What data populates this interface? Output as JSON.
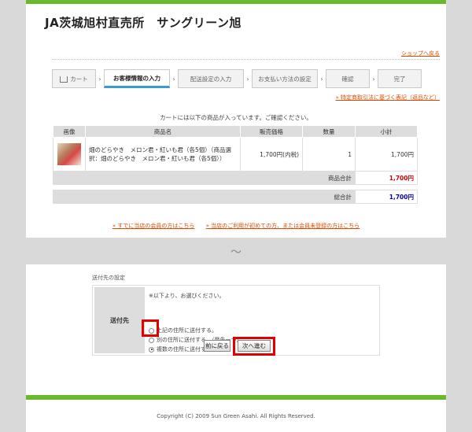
{
  "site": {
    "title": "JA茨城旭村直売所　サングリーン旭"
  },
  "links": {
    "shop": "ショップへ戻る",
    "law": "» 特定商取引法に基づく表記（返品など）",
    "member": "» すでに当店の会員の方はこちら",
    "nonmember": "» 当店のご利用が初めての方、または会員未登録の方はこちら"
  },
  "steps": [
    {
      "label": "カート"
    },
    {
      "label": "お客様情報の入力"
    },
    {
      "label": "配送設定の入力"
    },
    {
      "label": "お支払い方法の設定"
    },
    {
      "label": "確認"
    },
    {
      "label": "完了"
    }
  ],
  "intro": "カートには以下の商品が入っています。ご確認ください。",
  "cart": {
    "headers": [
      "画像",
      "商品名",
      "販売価格",
      "数量",
      "小計"
    ],
    "item": {
      "name": "畑のどらやき　メロン君・紅いも君（各5個）（商品選択：畑のどらやき　メロン君・紅いも君（各5個））",
      "price": "1,700円(内税)",
      "qty": "1",
      "subtotal": "1,700円"
    },
    "product_total_label": "商品合計",
    "product_total": "1,700円",
    "grand_total_label": "総合計",
    "grand_total": "1,700円",
    "colors": {
      "product_total": "#cc0000",
      "grand_total": "#0000aa"
    }
  },
  "divider": "〜",
  "shipping": {
    "section_label": "送付先の設定",
    "head": "送付先",
    "note": "※以下より、お選びください。",
    "options": [
      {
        "label": "上記の住所に送付する。",
        "selected": false
      },
      {
        "label": "別の住所に送付する。（発先一つ）",
        "selected": false
      },
      {
        "label": "複数の住所に送付する。",
        "selected": true
      }
    ],
    "back": "前に戻る",
    "next": "次へ進む"
  },
  "footer": {
    "copyright": "Copyright (C) 2009 Sun Green Asahi. All Rights Reserved."
  },
  "colors": {
    "brand_green": "#6ab82c",
    "link_red": "#e04a00",
    "highlight": "#e00000"
  }
}
